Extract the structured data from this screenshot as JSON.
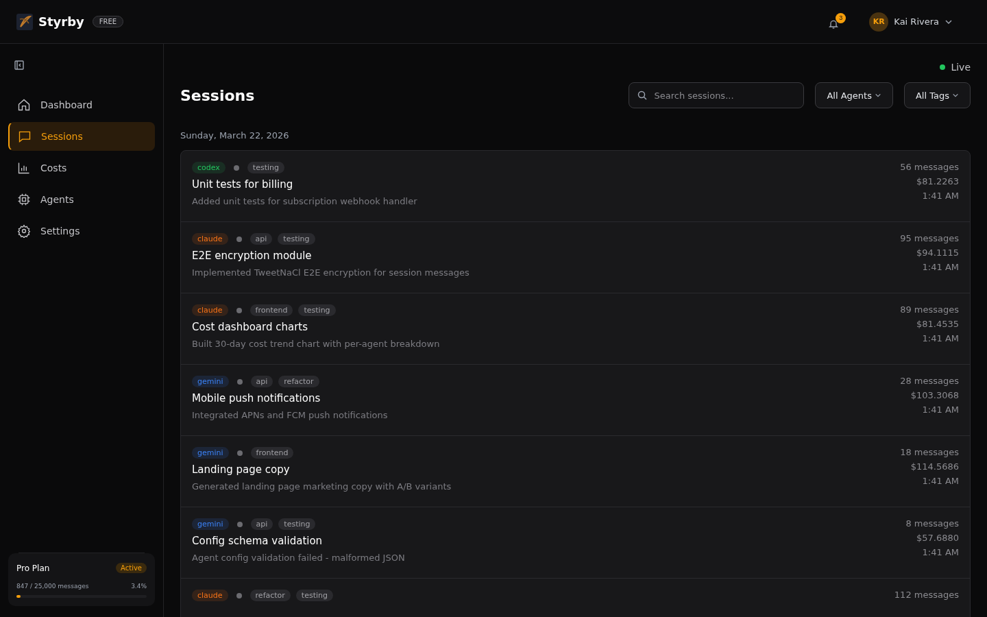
{
  "header": {
    "brand": "Styrby",
    "plan_badge": "FREE",
    "notifications": "3",
    "user": {
      "initials": "KR",
      "name": "Kai Rivera"
    }
  },
  "sidebar": {
    "items": [
      {
        "label": "Dashboard",
        "selected": false
      },
      {
        "label": "Sessions",
        "selected": true
      },
      {
        "label": "Costs",
        "selected": false
      },
      {
        "label": "Agents",
        "selected": false
      },
      {
        "label": "Settings",
        "selected": false
      }
    ],
    "plan": {
      "name": "Pro Plan",
      "status": "Active",
      "usage": "847 / 25,000 messages",
      "percent": "3.4%",
      "level": 0.034
    }
  },
  "live": "Live",
  "title": "Sessions",
  "search": {
    "placeholder": "Search sessions..."
  },
  "filters": [
    "All Agents",
    "All Tags"
  ],
  "date": "Sunday, March 22, 2026",
  "sessions": [
    {
      "agent": {
        "label": "codex",
        "color": "#22c55e"
      },
      "tags": [
        "testing"
      ],
      "title": "Unit tests for billing",
      "summary": "Added unit tests for subscription webhook handler",
      "messages": "56 messages",
      "cost": "$81.2263",
      "time": "1:41 AM"
    },
    {
      "agent": {
        "label": "claude",
        "color": "#f97316"
      },
      "tags": [
        "api",
        "testing"
      ],
      "title": "E2E encryption module",
      "summary": "Implemented TweetNaCl E2E encryption for session messages",
      "messages": "95 messages",
      "cost": "$94.1115",
      "time": "1:41 AM"
    },
    {
      "agent": {
        "label": "claude",
        "color": "#f97316"
      },
      "tags": [
        "frontend",
        "testing"
      ],
      "title": "Cost dashboard charts",
      "summary": "Built 30-day cost trend chart with per-agent breakdown",
      "messages": "89 messages",
      "cost": "$81.4535",
      "time": "1:41 AM"
    },
    {
      "agent": {
        "label": "gemini",
        "color": "#3b82f6"
      },
      "tags": [
        "api",
        "refactor"
      ],
      "title": "Mobile push notifications",
      "summary": "Integrated APNs and FCM push notifications",
      "messages": "28 messages",
      "cost": "$103.3068",
      "time": "1:41 AM"
    },
    {
      "agent": {
        "label": "gemini",
        "color": "#3b82f6"
      },
      "tags": [
        "frontend"
      ],
      "title": "Landing page copy",
      "summary": "Generated landing page marketing copy with A/B variants",
      "messages": "18 messages",
      "cost": "$114.5686",
      "time": "1:41 AM"
    },
    {
      "agent": {
        "label": "gemini",
        "color": "#3b82f6"
      },
      "tags": [
        "api",
        "testing"
      ],
      "title": "Config schema validation",
      "summary": "Agent config validation failed - malformed JSON",
      "messages": "8 messages",
      "cost": "$57.6880",
      "time": "1:41 AM"
    },
    {
      "agent": {
        "label": "claude",
        "color": "#f97316"
      },
      "tags": [
        "refactor",
        "testing"
      ],
      "messages": "112 messages"
    }
  ]
}
